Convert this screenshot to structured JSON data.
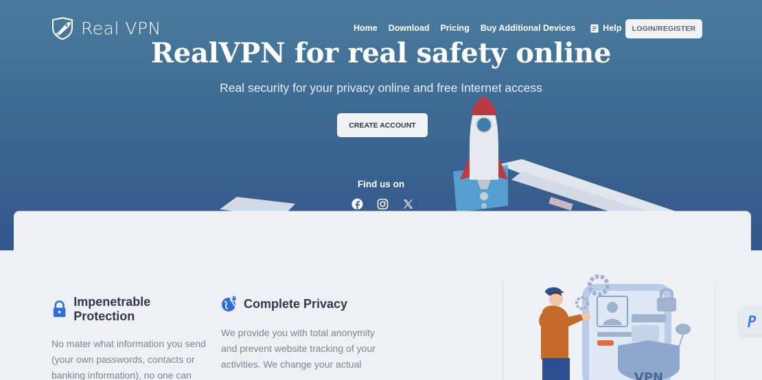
{
  "brand": {
    "name": "Real VPN"
  },
  "nav": {
    "items": [
      "Home",
      "Download",
      "Pricing",
      "Buy Additional Devices"
    ],
    "help_label": "Help",
    "login_label": "LOGIN/REGISTER"
  },
  "hero": {
    "title": "RealVPN for real safety online",
    "subtitle": "Real security for your privacy online and free Internet access",
    "cta_label": "CREATE ACCOUNT",
    "find_us": "Find us on"
  },
  "features": [
    {
      "title": "Impenetrable Protection",
      "icon": "lock-icon",
      "text": "No mater what information you send (your own passwords, contacts or banking information), no one can"
    },
    {
      "title": "Complete Privacy",
      "icon": "globe-icon",
      "text": "We provide you with total anonymity and prevent website tracking of your activities. We change your actual"
    }
  ],
  "illustration": {
    "label": "VPN"
  },
  "colors": {
    "hero_top": "#4a7c9e",
    "hero_bottom": "#34568a",
    "accent": "#2c6fd6",
    "heading": "#2d3a4d"
  }
}
